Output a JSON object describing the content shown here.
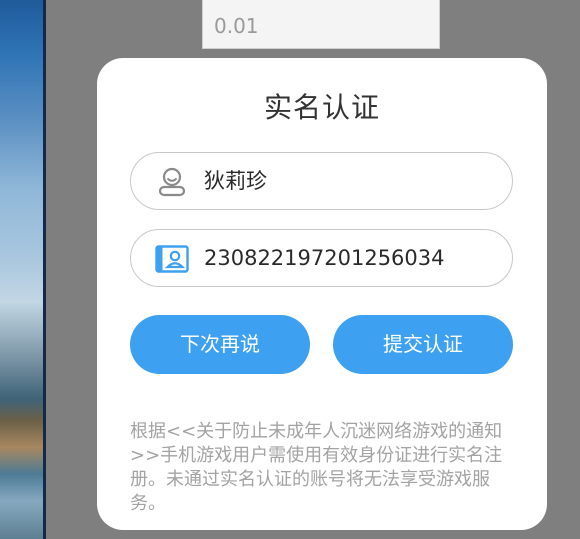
{
  "background_input": {
    "value": "0.01"
  },
  "dialog": {
    "title": "实名认证",
    "name_field": {
      "value": "狄莉珍",
      "icon": "user-avatar-icon"
    },
    "id_field": {
      "value": "230822197201256034",
      "icon": "id-card-icon"
    },
    "buttons": {
      "later_label": "下次再说",
      "submit_label": "提交认证"
    },
    "notice": "根据<<关于防止未成年人沉迷网络游戏的通知>>手机游戏用户需使用有效身份证进行实名注册。未通过实名认证的账号将无法享受游戏服务。"
  },
  "colors": {
    "accent": "#3ea0f0",
    "overlay": "#7f7f7f",
    "notice_text": "#a3a3a3"
  }
}
